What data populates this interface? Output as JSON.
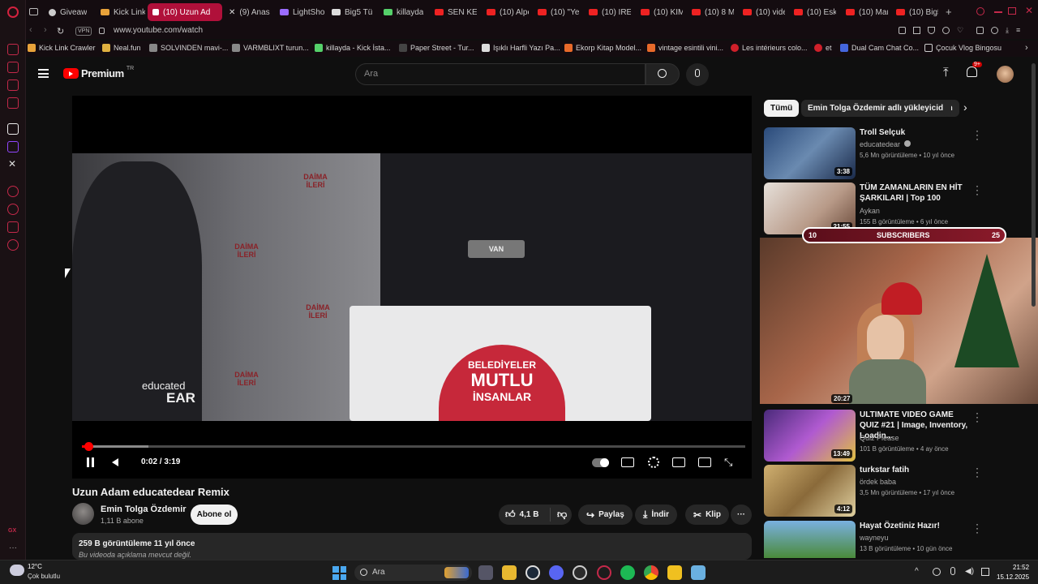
{
  "browser": {
    "tabs": [
      {
        "label": "Giveaw",
        "color": "#cccccc"
      },
      {
        "label": "Kick Link",
        "color": "#e8a23a"
      },
      {
        "label": "(10) Uzun Ad",
        "color": "#ffffff"
      },
      {
        "label": "(9) Anas",
        "color": "#cccccc"
      },
      {
        "label": "LightSho",
        "color": "#9a6cff"
      },
      {
        "label": "Big5 Tür",
        "color": "#dddddd"
      },
      {
        "label": "killayda",
        "color": "#55d06a"
      },
      {
        "label": "SEN KEN",
        "color": "#ee2222"
      },
      {
        "label": "(10) Alpe",
        "color": "#ee2222"
      },
      {
        "label": "(10) \"Ye",
        "color": "#ee2222"
      },
      {
        "label": "(10) İREM",
        "color": "#ee2222"
      },
      {
        "label": "(10) KİM",
        "color": "#ee2222"
      },
      {
        "label": "(10) 8 M",
        "color": "#ee2222"
      },
      {
        "label": "(10) vide",
        "color": "#ee2222"
      },
      {
        "label": "(10) Eski",
        "color": "#ee2222"
      },
      {
        "label": "(10) Mar",
        "color": "#ee2222"
      },
      {
        "label": "(10) Big5",
        "color": "#ee2222"
      }
    ],
    "vpn_label": "VPN",
    "url": "www.youtube.com/watch",
    "bookmarks": [
      {
        "label": "Kick Link Crawler",
        "color": "#e8a23a"
      },
      {
        "label": "Neal.fun",
        "color": "#e0b040"
      },
      {
        "label": "SOLVINDEN mavi-...",
        "color": "#888888"
      },
      {
        "label": "VARMBLIXT turun...",
        "color": "#888888"
      },
      {
        "label": "killayda - Kick İsta...",
        "color": "#55d06a"
      },
      {
        "label": "Paper Street - Tur...",
        "color": "#444444"
      },
      {
        "label": "Işıklı Harfli Yazı Pa...",
        "color": "#dddddd"
      },
      {
        "label": "Ekorp Kitap Model...",
        "color": "#e86a2a"
      },
      {
        "label": "vintage esintili vini...",
        "color": "#e86a2a"
      },
      {
        "label": "Les intérieurs colo...",
        "color": "#d0202a"
      },
      {
        "label": "et",
        "color": "#d0202a"
      },
      {
        "label": "Dual Cam Chat Co...",
        "color": "#4466dd"
      },
      {
        "label": "Çocuk Vlog Bingosu",
        "color": "#cccccc"
      }
    ]
  },
  "youtube": {
    "logo_text": "Premium",
    "logo_region": "TR",
    "search_placeholder": "Ara",
    "notif_count": "9+",
    "player": {
      "time": "0:02 / 3:19",
      "progress": 0.01,
      "buffered": 0.1,
      "watermark_small": "educated",
      "watermark_big": "EAR",
      "mic_label": "VAN",
      "backdrop_text": "DAİMA İLERİ",
      "sign_line1": "BELEDİYELER",
      "sign_line2": "MUTLU",
      "sign_line3": "İNSANLAR"
    },
    "video": {
      "title": "Uzun Adam educatedear Remix",
      "channel": "Emin Tolga Özdemir",
      "subscribers": "1,11 B abone",
      "subscribe_label": "Abone ol",
      "likes": "4,1 B",
      "share_label": "Paylaş",
      "download_label": "İndir",
      "clip_label": "Klip",
      "desc_meta": "259 B görüntüleme  11 yıl önce",
      "desc_text": "Bu videoda açıklama mevcut değil."
    },
    "chips": [
      "Tümü",
      "Emin Tolga Özdemir adlı yükleyiciden"
    ],
    "recommendations": [
      {
        "title": "Troll Selçuk",
        "channel": "educatedear",
        "verified": true,
        "meta": "5,6 Mn görüntüleme • 10 yıl önce",
        "duration": "3:38",
        "thumb_color": "#3a5a8a"
      },
      {
        "title": "TÜM ZAMANLARIN EN HİT ŞARKILARI | Top 100",
        "channel": "Aykan",
        "meta": "155 B görüntüleme • 6 yıl önce",
        "duration": "21:55",
        "thumb_color": "#d6cfc8"
      },
      {
        "title": "ULTIMATE VIDEO GAME QUIZ #21 | Image, Inventory, Loadin...",
        "channel": "Quiz Please",
        "meta": "101 B görüntüleme • 4 ay önce",
        "duration": "13:49",
        "thumb_color": "#6a3aa8"
      },
      {
        "title": "turkstar fatih",
        "channel": "ördek baba",
        "meta": "3,5 Mn görüntüleme • 17 yıl önce",
        "duration": "4:12",
        "thumb_color": "#b89a5a"
      },
      {
        "title": "Hayat Özetiniz Hazır!",
        "channel": "wayneyu",
        "meta": "13 B görüntüleme • 10 gün önce",
        "duration": "",
        "thumb_color": "#5a9ad0"
      }
    ],
    "stream_overlay": {
      "goal_left": "10",
      "goal_label": "SUBSCRIBERS",
      "goal_right": "25",
      "duration": "20:27"
    }
  },
  "taskbar": {
    "weather_temp": "12°C",
    "weather_desc": "Çok bulutlu",
    "search_placeholder": "Ara",
    "time": "21:52",
    "date": "15.12.2025"
  }
}
